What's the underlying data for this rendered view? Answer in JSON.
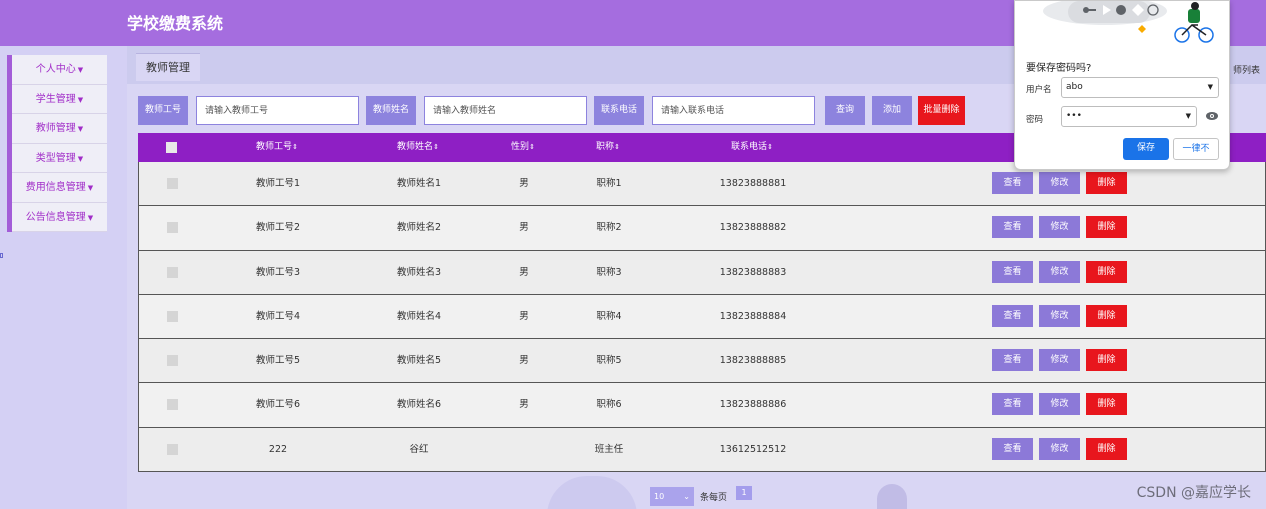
{
  "app": {
    "title": "学校缴费系统"
  },
  "sidebar": {
    "items": [
      {
        "label": "个人中心"
      },
      {
        "label": "学生管理"
      },
      {
        "label": "教师管理"
      },
      {
        "label": "类型管理"
      },
      {
        "label": "费用信息管理"
      },
      {
        "label": "公告信息管理"
      }
    ],
    "caret": "▼"
  },
  "tabs": {
    "active": "教师管理"
  },
  "breadcrumb": {
    "current": "师列表"
  },
  "search": {
    "teacher_no_label": "教师工号",
    "teacher_no_placeholder": "请输入教师工号",
    "teacher_name_label": "教师姓名",
    "teacher_name_placeholder": "请输入教师姓名",
    "phone_label": "联系电话",
    "phone_placeholder": "请输入联系电话",
    "query_label": "查询",
    "add_label": "添加",
    "batch_delete_label": "批量删除"
  },
  "table": {
    "headers": {
      "teacher_no": "教师工号",
      "teacher_name": "教师姓名",
      "gender": "性别",
      "title": "职称",
      "phone": "联系电话"
    },
    "sort_glyph": "⇕",
    "rows": [
      {
        "teacher_no": "教师工号1",
        "teacher_name": "教师姓名1",
        "gender": "男",
        "title": "职称1",
        "phone": "13823888881"
      },
      {
        "teacher_no": "教师工号2",
        "teacher_name": "教师姓名2",
        "gender": "男",
        "title": "职称2",
        "phone": "13823888882"
      },
      {
        "teacher_no": "教师工号3",
        "teacher_name": "教师姓名3",
        "gender": "男",
        "title": "职称3",
        "phone": "13823888883"
      },
      {
        "teacher_no": "教师工号4",
        "teacher_name": "教师姓名4",
        "gender": "男",
        "title": "职称4",
        "phone": "13823888884"
      },
      {
        "teacher_no": "教师工号5",
        "teacher_name": "教师姓名5",
        "gender": "男",
        "title": "职称5",
        "phone": "13823888885"
      },
      {
        "teacher_no": "教师工号6",
        "teacher_name": "教师姓名6",
        "gender": "男",
        "title": "职称6",
        "phone": "13823888886"
      },
      {
        "teacher_no": "222",
        "teacher_name": "谷红",
        "gender": "",
        "title": "班主任",
        "phone": "13612512512"
      }
    ],
    "actions": {
      "view": "查看",
      "edit": "修改",
      "delete": "删除"
    }
  },
  "pager": {
    "page_size": "10",
    "page_size_suffix": "条每页",
    "current_page": "1"
  },
  "watermark": "CSDN @嘉应学长",
  "password_popup": {
    "title": "要保存密码吗?",
    "username_label": "用户名",
    "username_value": "abo",
    "password_label": "密码",
    "password_value": "•••",
    "save_label": "保存",
    "never_label": "一律不",
    "accent_color": "#1a73e8"
  },
  "colors": {
    "header": "#a56ddf",
    "table_header": "#8e1fc4",
    "button": "#8d83de",
    "danger": "#e8161d",
    "sidebar_text": "#a12ec8"
  }
}
